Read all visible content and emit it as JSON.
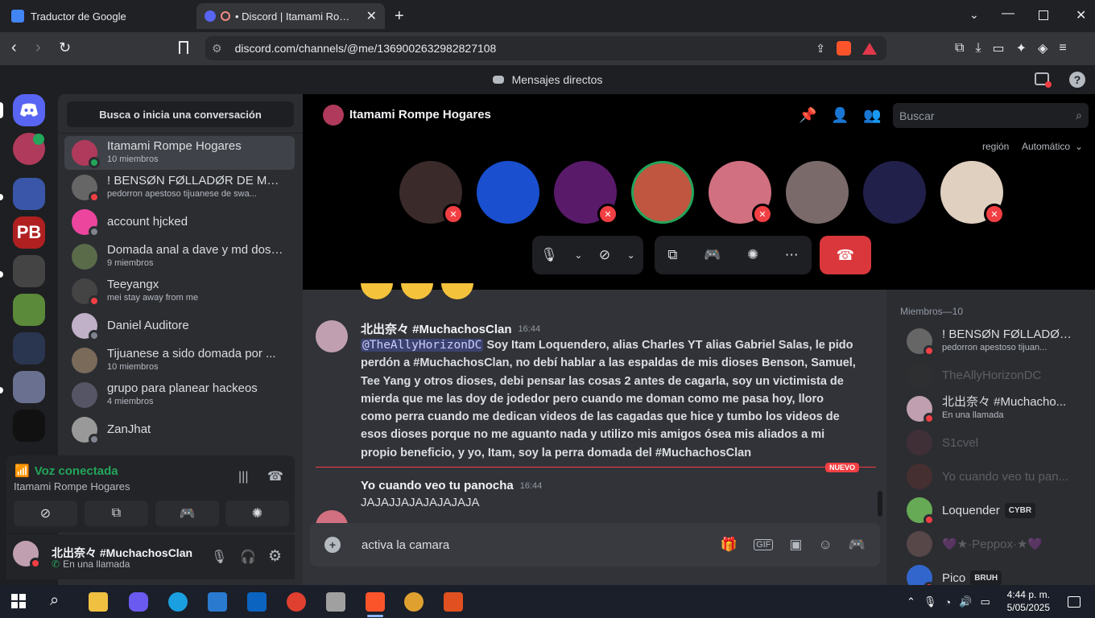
{
  "browser": {
    "tabs": [
      {
        "title": "Traductor de Google"
      },
      {
        "title": "• Discord | Itamami Rompe l"
      }
    ],
    "url": "discord.com/channels/@me/1369002632982827108"
  },
  "discord": {
    "topbar_title": "Mensajes directos",
    "dm_search_placeholder": "Busca o inicia una conversación",
    "dms": [
      {
        "name": "Itamami Rompe Hogares",
        "sub": "10 miembros",
        "color": "#b03a5b"
      },
      {
        "name": "! BΕΝSØΝ FØLLΑDØR DE MA...",
        "sub": "pedorron apestoso tijuanese de swa...",
        "color": "#666"
      },
      {
        "name": "account hjcked",
        "sub": "",
        "color": "#eb459e"
      },
      {
        "name": "Domada anal a dave y md dos ...",
        "sub": "9 miembros",
        "color": "#5a6b4a"
      },
      {
        "name": "Teeyangx",
        "sub": "mei stay away from me",
        "color": "#444"
      },
      {
        "name": "Daniel Auditore",
        "sub": "",
        "color": "#c0b0c8"
      },
      {
        "name": "Tijuanese a sido domada por ...",
        "sub": "10 miembros",
        "color": "#7a6a5a"
      },
      {
        "name": "grupo para planear hackeos",
        "sub": "4 miembros",
        "color": "#556"
      },
      {
        "name": "ZanJhat",
        "sub": "",
        "color": "#999"
      }
    ],
    "voice": {
      "status": "Voz conectada",
      "channel": "Itamami Rompe Hogares"
    },
    "user": {
      "name": "北出奈々 #MuchachosClan",
      "status": "En una llamada"
    },
    "channel": {
      "title": "Itamami Rompe Hogares",
      "search_placeholder": "Buscar",
      "region_label": "región",
      "region_value": "Automático"
    },
    "messages": [
      {
        "author": "北出奈々 #MuchachosClan",
        "time": "16:44",
        "mention": "@TheAllyHorizonDC",
        "text": "Soy Itam Loquendero, alias Charles YT alias Gabriel Salas, le pido perdón a #MuchachosClan, no debí hablar a las espaldas de mis dioses Benson, Samuel, Tee Yang y otros dioses, debi pensar las cosas 2 antes de cagarla, soy un victimista de mierda que me las doy de jodedor pero cuando me doman como me pasa hoy, lloro como perra cuando me dedican videos de las cagadas que hice y tumbo los videos de esos dioses porque no me aguanto nada y utilizo mis amigos ósea mis aliados a mi propio beneficio, y yo, Itam, soy la perra domada del #MuchachosClan"
      },
      {
        "author": "Yo cuando veo tu panocha",
        "time": "16:44",
        "text": "JAJAJJAJAJAJAJAJA"
      }
    ],
    "new_badge": "NUEVO",
    "composer_value": "activa la camara",
    "members_header": "Miembros—10",
    "members": [
      {
        "name": "! BΕΝSØΝ FØLLΑDØR...",
        "sub": "pedorron apestoso tijuan...",
        "dim": false,
        "color": "#666"
      },
      {
        "name": "TheAllyHorizonDC",
        "sub": "",
        "dim": true,
        "color": "#333"
      },
      {
        "name": "北出奈々 #Muchacho...",
        "sub": "En una llamada",
        "dim": false,
        "color": "#c0a0b0"
      },
      {
        "name": "S1cvel",
        "sub": "",
        "dim": true,
        "color": "#634"
      },
      {
        "name": "Yo cuando veo tu pan...",
        "sub": "",
        "dim": true,
        "color": "#733"
      },
      {
        "name": "Loquender",
        "sub": "",
        "tag": "CYBR",
        "dim": false,
        "color": "#6a5"
      },
      {
        "name": "💜★·Peppox·★💜",
        "sub": "",
        "dim": true,
        "color": "#a77"
      },
      {
        "name": "Pico",
        "sub": "",
        "tag": "BRUH",
        "dim": false,
        "color": "#36c"
      }
    ]
  },
  "taskbar": {
    "time": "4:44 p. m.",
    "date": "5/05/2025"
  }
}
